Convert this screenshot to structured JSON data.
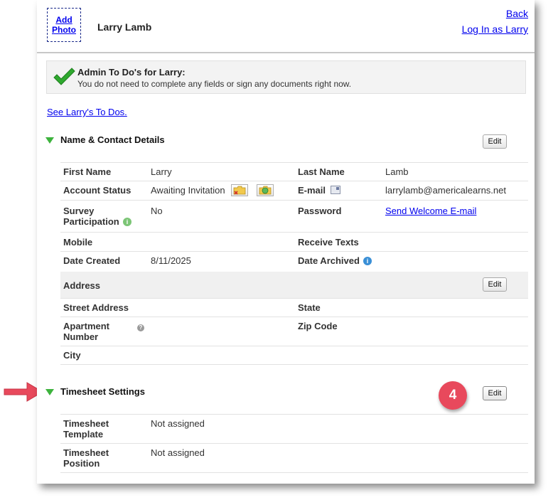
{
  "header": {
    "add_photo_line1": "Add",
    "add_photo_line2": "Photo",
    "user_name": "Larry Lamb",
    "back": "Back",
    "login_as": "Log In as Larry"
  },
  "todo": {
    "title": "Admin To Do's for Larry:",
    "message": "You do not need to complete any fields or sign any documents right now.",
    "see_link": "See Larry's To Dos."
  },
  "contact": {
    "section_title": "Name & Contact Details",
    "edit_label": "Edit",
    "first_name_label": "First Name",
    "first_name": "Larry",
    "last_name_label": "Last Name",
    "last_name": "Lamb",
    "account_status_label": "Account Status",
    "account_status": "Awaiting Invitation",
    "email_label": "E-mail",
    "email": "larrylamb@americalearns.net",
    "survey_label_1": "Survey",
    "survey_label_2": "Participation",
    "survey_value": "No",
    "password_label": "Password",
    "send_welcome": "Send Welcome E-mail",
    "mobile_label": "Mobile",
    "receive_texts_label": "Receive Texts",
    "date_created_label": "Date Created",
    "date_created": "8/11/2025",
    "date_archived_label": "Date Archived"
  },
  "address": {
    "title": "Address",
    "edit_label": "Edit",
    "street_label": "Street Address",
    "state_label": "State",
    "apt_label_1": "Apartment",
    "apt_label_2": "Number",
    "zip_label": "Zip Code",
    "city_label": "City"
  },
  "timesheet": {
    "section_title": "Timesheet Settings",
    "edit_label": "Edit",
    "template_label_1": "Timesheet",
    "template_label_2": "Template",
    "template_value": "Not assigned",
    "position_label_1": "Timesheet",
    "position_label_2": "Position",
    "position_value": "Not assigned"
  },
  "annotation": {
    "step_number": "4",
    "arrow_color": "#e8495c",
    "badge_color": "#e8495c"
  },
  "colors": {
    "link": "#0000ee",
    "section_triangle": "#3db33d",
    "check": "#2fa92f"
  }
}
